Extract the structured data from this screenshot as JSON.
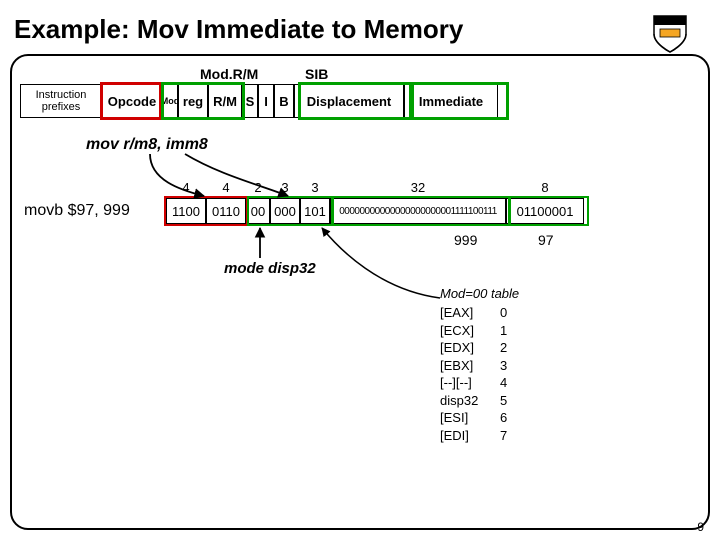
{
  "title": "Example: Mov Immediate to Memory",
  "slide_number": "9",
  "header_labels": {
    "modrm": "Mod.R/M",
    "sib": "SIB"
  },
  "format": {
    "prefix": "Instruction prefixes",
    "opcode": "Opcode",
    "mod": "Mod",
    "reg": "reg",
    "rm": "R/M",
    "s": "S",
    "i": "I",
    "b": "B",
    "disp": "Displacement",
    "imm": "Immediate"
  },
  "mnemonic": "mov r/m8, imm8",
  "encoding": {
    "lhs": "movb $97, 999",
    "widths": [
      "4",
      "4",
      "2",
      "3",
      "3",
      "32",
      "8"
    ],
    "op1": "1100",
    "op2": "0110",
    "mod": "00",
    "reg": "000",
    "rm": "101",
    "disp": "00000000000000000000001111100111",
    "imm": "01100001"
  },
  "labels_below": {
    "disp_val": "999",
    "imm_val": "97"
  },
  "mode_label": "mode disp32",
  "mod_table": {
    "header": "Mod=00 table",
    "rows": [
      {
        "reg": "[EAX]",
        "val": "0"
      },
      {
        "reg": "[ECX]",
        "val": "1"
      },
      {
        "reg": "[EDX]",
        "val": "2"
      },
      {
        "reg": "[EBX]",
        "val": "3"
      },
      {
        "reg": "[--][--]",
        "val": "4"
      },
      {
        "reg": "disp32",
        "val": "5"
      },
      {
        "reg": "[ESI]",
        "val": "6"
      },
      {
        "reg": "[EDI]",
        "val": "7"
      }
    ]
  }
}
